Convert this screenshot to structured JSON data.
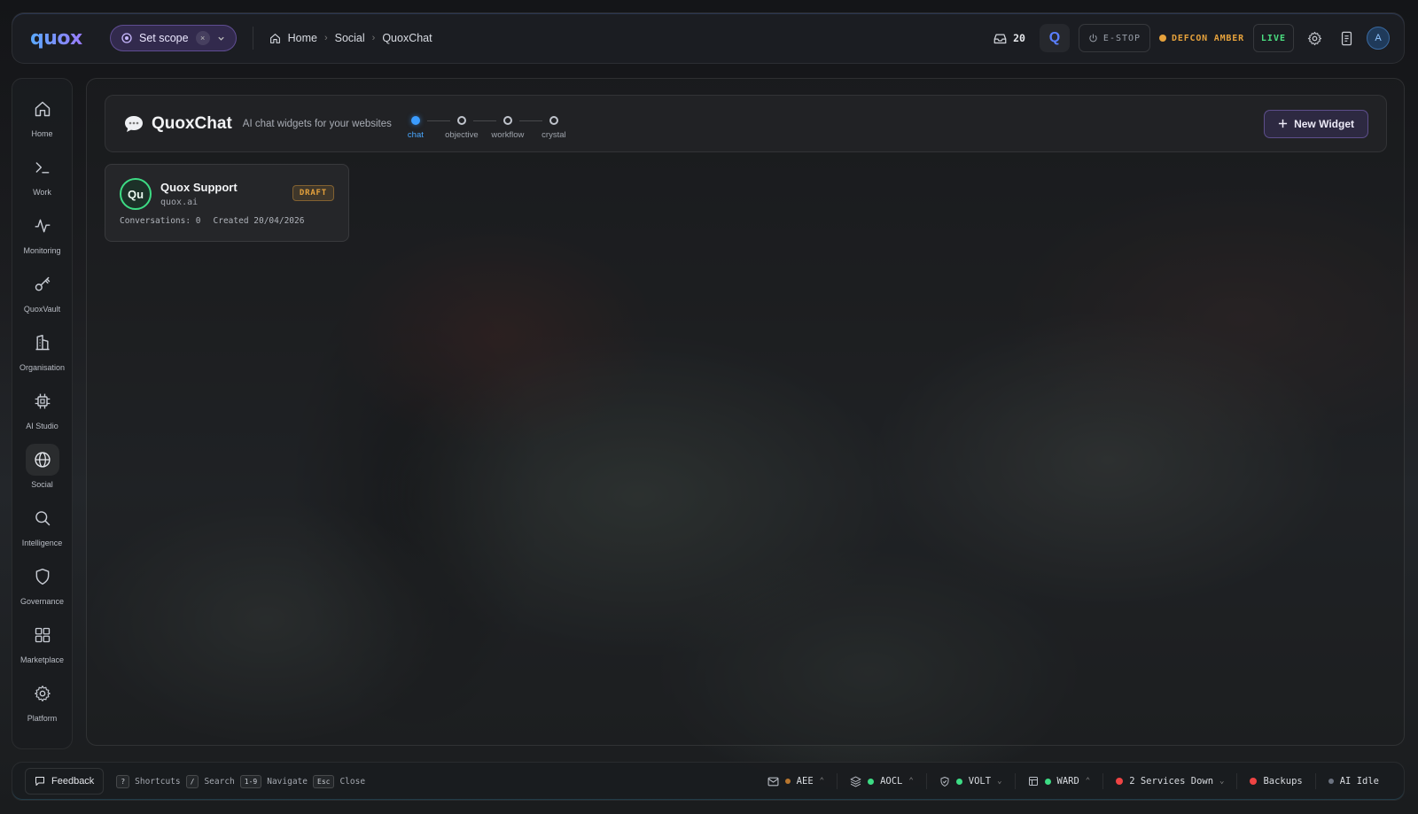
{
  "topbar": {
    "logo": "quox",
    "scope_label": "Set scope",
    "scope_clear": "×",
    "breadcrumbs": [
      "Home",
      "Social",
      "QuoxChat"
    ],
    "inbox_count": "20",
    "q_label": "Q",
    "estop_label": "E-STOP",
    "defcon_label": "DEFCON AMBER",
    "live_label": "LIVE",
    "avatar_initial": "A"
  },
  "nav": {
    "items": [
      {
        "label": "Home",
        "icon": "home-icon"
      },
      {
        "label": "Work",
        "icon": "terminal-icon"
      },
      {
        "label": "Monitoring",
        "icon": "activity-icon"
      },
      {
        "label": "QuoxVault",
        "icon": "key-icon"
      },
      {
        "label": "Organisation",
        "icon": "building-icon"
      },
      {
        "label": "AI Studio",
        "icon": "chip-icon"
      },
      {
        "label": "Social",
        "icon": "globe-icon",
        "active": true
      },
      {
        "label": "Intelligence",
        "icon": "search-icon"
      },
      {
        "label": "Governance",
        "icon": "shield-icon"
      },
      {
        "label": "Marketplace",
        "icon": "grid-icon"
      },
      {
        "label": "Platform",
        "icon": "gear-icon"
      }
    ]
  },
  "header": {
    "title": "QuoxChat",
    "subtitle": "AI chat widgets for your websites",
    "steps": [
      {
        "label": "chat",
        "active": true
      },
      {
        "label": "objective",
        "active": false
      },
      {
        "label": "workflow",
        "active": false
      },
      {
        "label": "crystal",
        "active": false
      }
    ],
    "new_widget_label": "New Widget"
  },
  "widgets": [
    {
      "initials": "Qu",
      "name": "Quox Support",
      "domain": "quox.ai",
      "status": "DRAFT",
      "conversations": "Conversations: 0",
      "created": "Created 20/04/2026"
    }
  ],
  "statusbar": {
    "feedback_label": "Feedback",
    "shortcuts": [
      {
        "key": "?",
        "label": "Shortcuts"
      },
      {
        "key": "/",
        "label": "Search"
      },
      {
        "key": "1-9",
        "label": "Navigate"
      },
      {
        "key": "Esc",
        "label": "Close"
      }
    ],
    "systems": [
      {
        "label": "AEE",
        "dot_color": "#b8762e"
      },
      {
        "label": "AOCL",
        "dot_color": "#3ddc84"
      },
      {
        "label": "VOLT",
        "dot_color": "#3ddc84"
      },
      {
        "label": "WARD",
        "dot_color": "#3ddc84"
      },
      {
        "label": "2 Services Down",
        "dot_color": "#ef4444"
      },
      {
        "label": "Backups",
        "dot_color": "#ef4444"
      },
      {
        "label": "AI Idle",
        "dot_color": "#6b7280"
      }
    ]
  },
  "colors": {
    "accent": "#3b9cff",
    "warning": "#e6a23c",
    "ok": "#3ddc84",
    "error": "#ef4444"
  }
}
